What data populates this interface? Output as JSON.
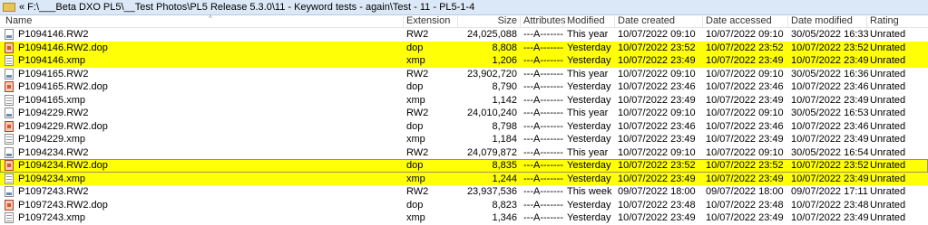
{
  "path": "« F:\\___Beta DXO PL5\\__Test Photos\\PL5 Release 5.3.0\\11 - Keyword tests - again\\Test - 11 - PL5-1-4",
  "columns": {
    "name": "Name",
    "extension": "Extension",
    "size": "Size",
    "attributes": "Attributes",
    "modified": "Modified",
    "created": "Date created",
    "accessed": "Date accessed",
    "date_modified": "Date modified",
    "rating": "Rating"
  },
  "colors": {
    "highlight": "#ffff05",
    "pathbar": "#dbe8f8"
  },
  "files": [
    {
      "name": "P1094146.RW2",
      "icon": "raw-file-icon",
      "ext": "RW2",
      "size": "24,025,088",
      "attr": "---A-------",
      "modified": "This year",
      "created": "10/07/2022 09:10",
      "accessed": "10/07/2022 09:10",
      "date_modified": "30/05/2022 16:33",
      "rating": "Unrated",
      "highlight": false,
      "selected": false
    },
    {
      "name": "P1094146.RW2.dop",
      "icon": "dop-file-icon",
      "ext": "dop",
      "size": "8,808",
      "attr": "---A-------",
      "modified": "Yesterday",
      "created": "10/07/2022 23:52",
      "accessed": "10/07/2022 23:52",
      "date_modified": "10/07/2022 23:52",
      "rating": "Unrated",
      "highlight": true,
      "selected": false
    },
    {
      "name": "P1094146.xmp",
      "icon": "xmp-file-icon",
      "ext": "xmp",
      "size": "1,206",
      "attr": "---A-------",
      "modified": "Yesterday",
      "created": "10/07/2022 23:49",
      "accessed": "10/07/2022 23:49",
      "date_modified": "10/07/2022 23:49",
      "rating": "Unrated",
      "highlight": true,
      "selected": false
    },
    {
      "name": "P1094165.RW2",
      "icon": "raw-file-icon",
      "ext": "RW2",
      "size": "23,902,720",
      "attr": "---A-------",
      "modified": "This year",
      "created": "10/07/2022 09:10",
      "accessed": "10/07/2022 09:10",
      "date_modified": "30/05/2022 16:36",
      "rating": "Unrated",
      "highlight": false,
      "selected": false
    },
    {
      "name": "P1094165.RW2.dop",
      "icon": "dop-file-icon",
      "ext": "dop",
      "size": "8,790",
      "attr": "---A-------",
      "modified": "Yesterday",
      "created": "10/07/2022 23:46",
      "accessed": "10/07/2022 23:46",
      "date_modified": "10/07/2022 23:46",
      "rating": "Unrated",
      "highlight": false,
      "selected": false
    },
    {
      "name": "P1094165.xmp",
      "icon": "xmp-file-icon",
      "ext": "xmp",
      "size": "1,142",
      "attr": "---A-------",
      "modified": "Yesterday",
      "created": "10/07/2022 23:49",
      "accessed": "10/07/2022 23:49",
      "date_modified": "10/07/2022 23:49",
      "rating": "Unrated",
      "highlight": false,
      "selected": false
    },
    {
      "name": "P1094229.RW2",
      "icon": "raw-file-icon",
      "ext": "RW2",
      "size": "24,010,240",
      "attr": "---A-------",
      "modified": "This year",
      "created": "10/07/2022 09:10",
      "accessed": "10/07/2022 09:10",
      "date_modified": "30/05/2022 16:53",
      "rating": "Unrated",
      "highlight": false,
      "selected": false
    },
    {
      "name": "P1094229.RW2.dop",
      "icon": "dop-file-icon",
      "ext": "dop",
      "size": "8,798",
      "attr": "---A-------",
      "modified": "Yesterday",
      "created": "10/07/2022 23:46",
      "accessed": "10/07/2022 23:46",
      "date_modified": "10/07/2022 23:46",
      "rating": "Unrated",
      "highlight": false,
      "selected": false
    },
    {
      "name": "P1094229.xmp",
      "icon": "xmp-file-icon",
      "ext": "xmp",
      "size": "1,184",
      "attr": "---A-------",
      "modified": "Yesterday",
      "created": "10/07/2022 23:49",
      "accessed": "10/07/2022 23:49",
      "date_modified": "10/07/2022 23:49",
      "rating": "Unrated",
      "highlight": false,
      "selected": false
    },
    {
      "name": "P1094234.RW2",
      "icon": "raw-file-icon",
      "ext": "RW2",
      "size": "24,079,872",
      "attr": "---A-------",
      "modified": "This year",
      "created": "10/07/2022 09:10",
      "accessed": "10/07/2022 09:10",
      "date_modified": "30/05/2022 16:54",
      "rating": "Unrated",
      "highlight": false,
      "selected": false
    },
    {
      "name": "P1094234.RW2.dop",
      "icon": "dop-file-icon",
      "ext": "dop",
      "size": "8,835",
      "attr": "---A-------",
      "modified": "Yesterday",
      "created": "10/07/2022 23:52",
      "accessed": "10/07/2022 23:52",
      "date_modified": "10/07/2022 23:52",
      "rating": "Unrated",
      "highlight": true,
      "selected": true
    },
    {
      "name": "P1094234.xmp",
      "icon": "xmp-file-icon",
      "ext": "xmp",
      "size": "1,244",
      "attr": "---A-------",
      "modified": "Yesterday",
      "created": "10/07/2022 23:49",
      "accessed": "10/07/2022 23:49",
      "date_modified": "10/07/2022 23:49",
      "rating": "Unrated",
      "highlight": true,
      "selected": false
    },
    {
      "name": "P1097243.RW2",
      "icon": "raw-file-icon",
      "ext": "RW2",
      "size": "23,937,536",
      "attr": "---A-------",
      "modified": "This week",
      "created": "09/07/2022 18:00",
      "accessed": "09/07/2022 18:00",
      "date_modified": "09/07/2022 17:11",
      "rating": "Unrated",
      "highlight": false,
      "selected": false
    },
    {
      "name": "P1097243.RW2.dop",
      "icon": "dop-file-icon",
      "ext": "dop",
      "size": "8,823",
      "attr": "---A-------",
      "modified": "Yesterday",
      "created": "10/07/2022 23:48",
      "accessed": "10/07/2022 23:48",
      "date_modified": "10/07/2022 23:48",
      "rating": "Unrated",
      "highlight": false,
      "selected": false
    },
    {
      "name": "P1097243.xmp",
      "icon": "xmp-file-icon",
      "ext": "xmp",
      "size": "1,346",
      "attr": "---A-------",
      "modified": "Yesterday",
      "created": "10/07/2022 23:49",
      "accessed": "10/07/2022 23:49",
      "date_modified": "10/07/2022 23:49",
      "rating": "Unrated",
      "highlight": false,
      "selected": false
    }
  ]
}
